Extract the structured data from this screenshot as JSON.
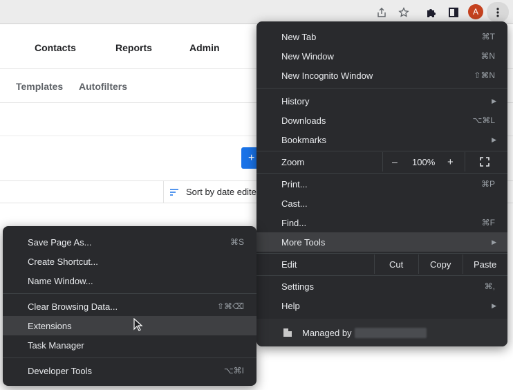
{
  "toolbar": {
    "avatar_letter": "A",
    "icons": [
      "share-icon",
      "star-icon",
      "extensions-puzzle-icon",
      "sidepanel-icon",
      "kebab-menu-icon"
    ]
  },
  "app_nav": {
    "items": [
      {
        "label": "Contacts"
      },
      {
        "label": "Reports"
      },
      {
        "label": "Admin"
      }
    ]
  },
  "subnav": {
    "items": [
      {
        "label": "Templates"
      },
      {
        "label": "Autofilters"
      }
    ]
  },
  "content": {
    "add_button_label": "+",
    "sort_label": "Sort by date edite"
  },
  "chrome_menu": {
    "new_tab": {
      "label": "New Tab",
      "shortcut": "⌘T"
    },
    "new_window": {
      "label": "New Window",
      "shortcut": "⌘N"
    },
    "new_incognito": {
      "label": "New Incognito Window",
      "shortcut": "⇧⌘N"
    },
    "history": {
      "label": "History"
    },
    "downloads": {
      "label": "Downloads",
      "shortcut": "⌥⌘L"
    },
    "bookmarks": {
      "label": "Bookmarks"
    },
    "zoom": {
      "label": "Zoom",
      "minus": "–",
      "value": "100%",
      "plus": "+"
    },
    "print": {
      "label": "Print...",
      "shortcut": "⌘P"
    },
    "cast": {
      "label": "Cast..."
    },
    "find": {
      "label": "Find...",
      "shortcut": "⌘F"
    },
    "more_tools": {
      "label": "More Tools"
    },
    "edit": {
      "label": "Edit",
      "cut": "Cut",
      "copy": "Copy",
      "paste": "Paste"
    },
    "settings": {
      "label": "Settings",
      "shortcut": "⌘,"
    },
    "help": {
      "label": "Help"
    },
    "managed": {
      "label": "Managed by"
    }
  },
  "more_tools_menu": {
    "save_page": {
      "label": "Save Page As...",
      "shortcut": "⌘S"
    },
    "create_shortcut": {
      "label": "Create Shortcut..."
    },
    "name_window": {
      "label": "Name Window..."
    },
    "clear_browsing": {
      "label": "Clear Browsing Data...",
      "shortcut": "⇧⌘⌫"
    },
    "extensions": {
      "label": "Extensions"
    },
    "task_manager": {
      "label": "Task Manager"
    },
    "developer_tools": {
      "label": "Developer Tools",
      "shortcut": "⌥⌘I"
    }
  },
  "colors": {
    "menu_bg": "#292a2d",
    "menu_text": "#e8eaed",
    "menu_highlight": "#3f4043",
    "accent_blue": "#1a73e8",
    "avatar_bg": "#c5421f"
  }
}
